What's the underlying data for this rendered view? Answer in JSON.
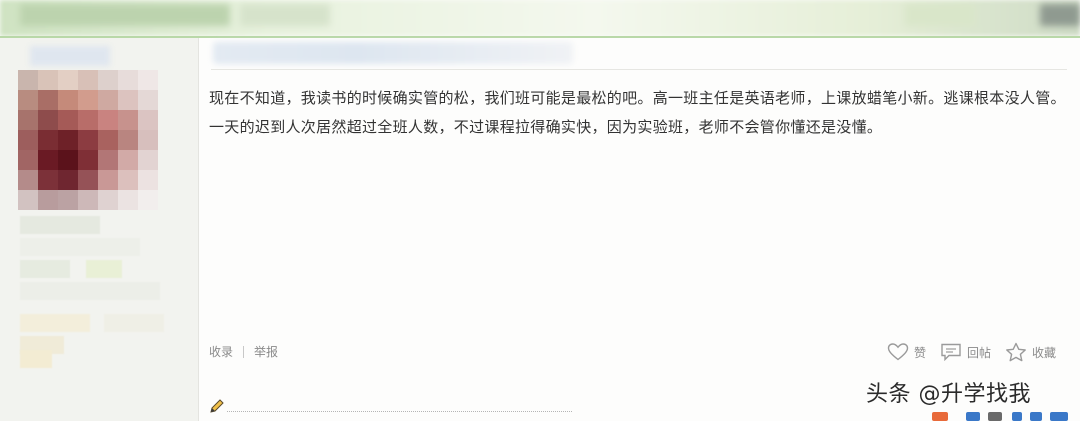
{
  "post": {
    "text": "现在不知道，我读书的时候确实管的松，我们班可能是最松的吧。高一班主任是英语老师，上课放蜡笔小新。逃课根本没人管。一天的迟到人次居然超过全班人数，不过课程拉得确实快，因为实验班，老师不会管你懂还是没懂。"
  },
  "actions_left": {
    "favorite_label": "收录",
    "report_label": "举报"
  },
  "actions_right": {
    "like_label": "赞",
    "reply_label": "回帖",
    "collect_label": "收藏"
  },
  "watermark": {
    "text": "头条 @升学找我"
  },
  "icons": {
    "like": "heart-icon",
    "reply": "comment-icon",
    "collect": "star-icon",
    "edit": "pencil-icon"
  },
  "colors": {
    "text": "#333333",
    "muted": "#8a8a8a",
    "top_accent": "#b9d8a8"
  }
}
